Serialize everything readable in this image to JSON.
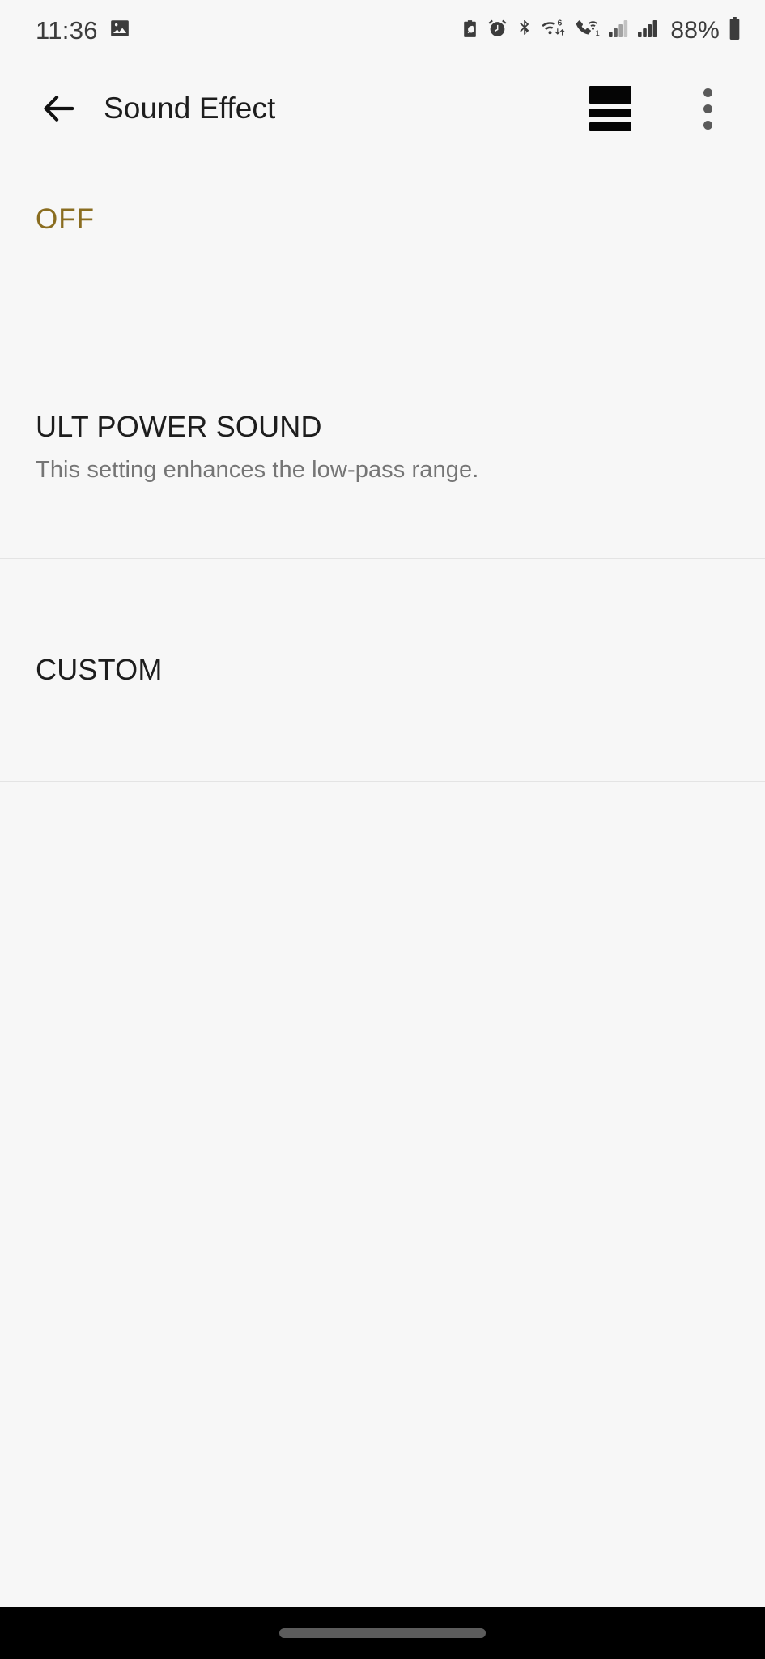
{
  "status_bar": {
    "time": "11:36",
    "battery_percent": "88%",
    "left_icons": [
      {
        "name": "photo-icon",
        "label": "Screenshot"
      }
    ],
    "right_icons": [
      {
        "name": "battery-saver-icon",
        "label": "Battery saver"
      },
      {
        "name": "alarm-icon",
        "label": "Alarm set"
      },
      {
        "name": "bluetooth-icon",
        "label": "Bluetooth on"
      },
      {
        "name": "wifi-6-icon",
        "label": "Wi-Fi 6"
      },
      {
        "name": "wifi-calling-icon",
        "label": "Wi-Fi calling 1"
      },
      {
        "name": "signal-bars-icon-sim1",
        "label": "SIM 1 signal"
      },
      {
        "name": "signal-bars-icon-sim2",
        "label": "SIM 2 signal"
      },
      {
        "name": "battery-icon",
        "label": "Battery"
      }
    ]
  },
  "app_bar": {
    "back_label": "Back",
    "title": "Sound Effect",
    "equalizer_label": "Equalizer",
    "overflow_label": "More options"
  },
  "list": {
    "state_row": {
      "value": "OFF",
      "accent_color": "#8a6d20"
    },
    "items": [
      {
        "title": "ULT POWER SOUND",
        "subtitle": "This setting enhances the low-pass range."
      },
      {
        "title": "CUSTOM",
        "subtitle": ""
      }
    ]
  },
  "navigation_bar": {
    "handle_label": "Home gesture handle"
  },
  "theme": {
    "background": "#f7f7f7",
    "divider": "#e4e4e4",
    "text_primary": "#1d1d1d",
    "text_secondary": "#757575",
    "accent": "#8a6d20",
    "nav_background": "#000000"
  }
}
